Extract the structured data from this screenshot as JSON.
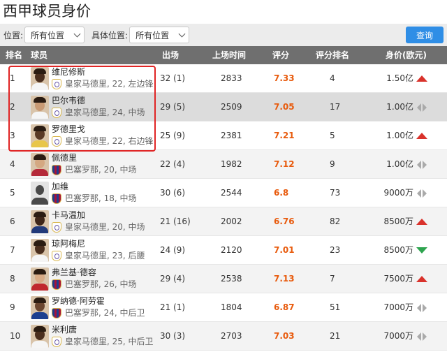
{
  "page_title": "西甲球员身价",
  "filters": {
    "position_label": "位置:",
    "position_value": "所有位置",
    "detail_label": "具体位置:",
    "detail_value": "所有位置",
    "query_label": "查询"
  },
  "columns": [
    "排名",
    "球员",
    "出场",
    "上场时间",
    "评分",
    "评分排名",
    "身价(欧元)"
  ],
  "colors": {
    "header_bg": "#6f6f6f",
    "rating": "#e85a0c",
    "up": "#d9322b",
    "down": "#2ea44f",
    "flat": "#aaaaaa",
    "button": "#2f8ee6",
    "highlight": "#e02424"
  },
  "rows": [
    {
      "rank": "1",
      "name": "维尼修斯",
      "team": "皇家马德里",
      "info": "皇家马德里, 22, 左边锋",
      "apps": "32 (1)",
      "minutes": "2833",
      "rating": "7.33",
      "rating_rank": "4",
      "value": "1.50亿",
      "trend": "up",
      "skin": "#4a2e1e",
      "shirt": "#f5f5f5"
    },
    {
      "rank": "2",
      "name": "巴尔韦德",
      "team": "皇家马德里",
      "info": "皇家马德里, 24, 中场",
      "apps": "29 (5)",
      "minutes": "2509",
      "rating": "7.05",
      "rating_rank": "17",
      "value": "1.00亿",
      "trend": "flat",
      "skin": "#c99a74",
      "shirt": "#f5f5f5"
    },
    {
      "rank": "3",
      "name": "罗德里戈",
      "team": "皇家马德里",
      "info": "皇家马德里, 22, 右边锋",
      "apps": "25 (9)",
      "minutes": "2381",
      "rating": "7.21",
      "rating_rank": "5",
      "value": "1.00亿",
      "trend": "up",
      "skin": "#5a3a26",
      "shirt": "#e8c64a"
    },
    {
      "rank": "4",
      "name": "佩德里",
      "team": "巴塞罗那",
      "info": "巴塞罗那, 20, 中场",
      "apps": "22 (4)",
      "minutes": "1982",
      "rating": "7.12",
      "rating_rank": "9",
      "value": "1.00亿",
      "trend": "flat",
      "skin": "#d4a882",
      "shirt": "#b52a3a"
    },
    {
      "rank": "5",
      "name": "加维",
      "team": "巴塞罗那",
      "info": "巴塞罗那, 18, 中场",
      "apps": "30 (6)",
      "minutes": "2544",
      "rating": "6.8",
      "rating_rank": "73",
      "value": "9000万",
      "trend": "flat",
      "skin": "silhouette",
      "shirt": "#555"
    },
    {
      "rank": "6",
      "name": "卡马温加",
      "team": "皇家马德里",
      "info": "皇家马德里, 20, 中场",
      "apps": "21 (16)",
      "minutes": "2002",
      "rating": "6.76",
      "rating_rank": "82",
      "value": "8500万",
      "trend": "up",
      "skin": "#3e2619",
      "shirt": "#223a7a"
    },
    {
      "rank": "7",
      "name": "琼阿梅尼",
      "team": "皇家马德里",
      "info": "皇家马德里, 23, 后腰",
      "apps": "24 (9)",
      "minutes": "2120",
      "rating": "7.01",
      "rating_rank": "23",
      "value": "8500万",
      "trend": "down",
      "skin": "#4a2e1e",
      "shirt": "#f5f5f5"
    },
    {
      "rank": "8",
      "name": "弗兰基·德容",
      "team": "巴塞罗那",
      "info": "巴塞罗那, 26, 中场",
      "apps": "29 (4)",
      "minutes": "2538",
      "rating": "7.13",
      "rating_rank": "7",
      "value": "7500万",
      "trend": "up",
      "skin": "#d8ab86",
      "shirt": "#c0282e"
    },
    {
      "rank": "9",
      "name": "罗纳德·阿劳霍",
      "team": "巴塞罗那",
      "info": "巴塞罗那, 24, 中后卫",
      "apps": "21 (1)",
      "minutes": "1804",
      "rating": "6.87",
      "rating_rank": "51",
      "value": "7000万",
      "trend": "flat",
      "skin": "#6b4630",
      "shirt": "#1d3f8f"
    },
    {
      "rank": "10",
      "name": "米利唐",
      "team": "皇家马德里",
      "info": "皇家马德里, 25, 中后卫",
      "apps": "30 (3)",
      "minutes": "2703",
      "rating": "7.03",
      "rating_rank": "21",
      "value": "7000万",
      "trend": "flat",
      "skin": "#4a2e1e",
      "shirt": "#f5f5f5"
    }
  ]
}
